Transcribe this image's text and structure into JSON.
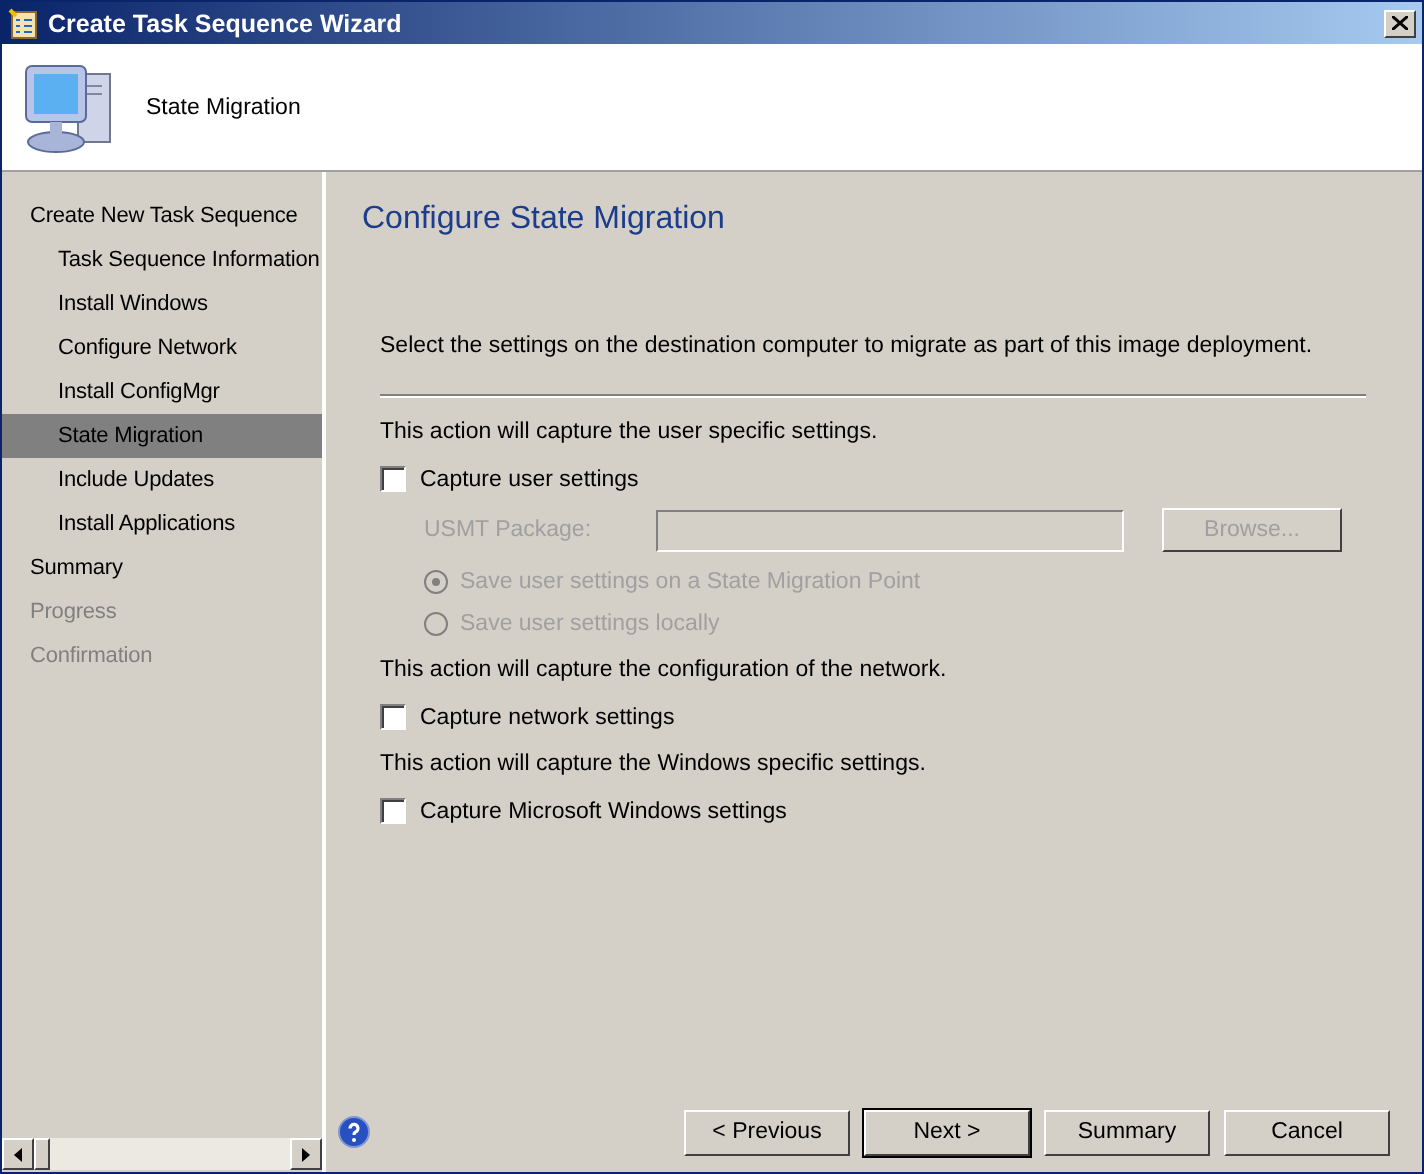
{
  "window": {
    "title": "Create Task Sequence Wizard"
  },
  "header": {
    "title": "State Migration"
  },
  "sidebar": {
    "items": [
      {
        "label": "Create New Task Sequence",
        "selected": false,
        "disabled": false,
        "children": [
          {
            "label": "Task Sequence Information",
            "selected": false,
            "disabled": false
          },
          {
            "label": "Install Windows",
            "selected": false,
            "disabled": false
          },
          {
            "label": "Configure Network",
            "selected": false,
            "disabled": false
          },
          {
            "label": "Install ConfigMgr",
            "selected": false,
            "disabled": false
          },
          {
            "label": "State Migration",
            "selected": true,
            "disabled": false
          },
          {
            "label": "Include Updates",
            "selected": false,
            "disabled": false
          },
          {
            "label": "Install Applications",
            "selected": false,
            "disabled": false
          }
        ]
      },
      {
        "label": "Summary",
        "selected": false,
        "disabled": false
      },
      {
        "label": "Progress",
        "selected": false,
        "disabled": true
      },
      {
        "label": "Confirmation",
        "selected": false,
        "disabled": true
      }
    ]
  },
  "page": {
    "title": "Configure State Migration",
    "intro": "Select the settings on the destination computer to migrate as part of this image deployment.",
    "sections": [
      {
        "description": "This action will capture the user specific settings.",
        "checkbox": {
          "label": "Capture user settings",
          "checked": false
        },
        "package": {
          "label": "USMT Package:",
          "disabled": true,
          "browse": "Browse..."
        },
        "options": [
          {
            "label": "Save user settings on a State Migration Point",
            "selected": true,
            "disabled": true
          },
          {
            "label": "Save user settings locally",
            "selected": false,
            "disabled": true
          }
        ]
      },
      {
        "description": "This action will capture the configuration of the network.",
        "checkbox": {
          "label": "Capture network settings",
          "checked": false
        }
      },
      {
        "description": "This action will capture the Windows specific settings.",
        "checkbox": {
          "label": "Capture Microsoft Windows settings",
          "checked": false
        }
      }
    ]
  },
  "buttons": [
    {
      "label": "< Previous",
      "default": false
    },
    {
      "label": "Next >",
      "default": true
    },
    {
      "label": "Summary",
      "default": false
    },
    {
      "label": "Cancel",
      "default": false
    }
  ]
}
